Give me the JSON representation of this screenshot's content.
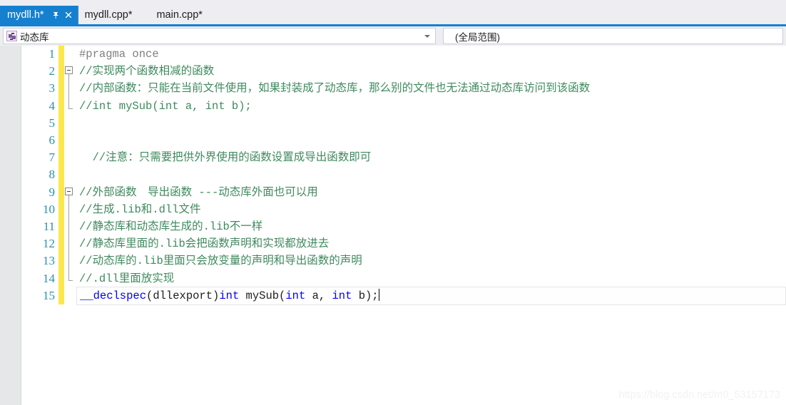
{
  "tabs": [
    {
      "label": "mydll.h*",
      "state": "active",
      "pin_icon": "pin-icon",
      "close_icon": "close-icon"
    },
    {
      "label": "mydll.cpp*",
      "state": "inactive"
    },
    {
      "label": "main.cpp*",
      "state": "plain"
    }
  ],
  "navbar": {
    "scope_combo": {
      "icon": "namespace-icon",
      "value": "动态库",
      "arrow_icon": "chevron-down-icon"
    },
    "member_combo": {
      "value": "(全局范围)"
    }
  },
  "editor": {
    "lines": [
      {
        "n": "1",
        "fold": "none",
        "changed": true,
        "text": "#pragma once"
      },
      {
        "n": "2",
        "fold": "start",
        "changed": true,
        "text": "//实现两个函数相减的函数"
      },
      {
        "n": "3",
        "fold": "mid",
        "changed": true,
        "text": "//内部函数：只能在当前文件使用，如果封装成了动态库，那么别的文件也无法通过动态库访问到该函数"
      },
      {
        "n": "4",
        "fold": "end",
        "changed": true,
        "text": "//int mySub(int a, int b);"
      },
      {
        "n": "5",
        "fold": "none",
        "changed": true,
        "text": ""
      },
      {
        "n": "6",
        "fold": "none",
        "changed": true,
        "text": ""
      },
      {
        "n": "7",
        "fold": "none",
        "changed": true,
        "text": "  //注意：只需要把供外界使用的函数设置成导出函数即可"
      },
      {
        "n": "8",
        "fold": "none",
        "changed": true,
        "text": ""
      },
      {
        "n": "9",
        "fold": "start",
        "changed": true,
        "text": "//外部函数　导出函数 ---动态库外面也可以用"
      },
      {
        "n": "10",
        "fold": "mid",
        "changed": true,
        "text": "//生成.lib和.dll文件"
      },
      {
        "n": "11",
        "fold": "mid",
        "changed": true,
        "text": "//静态库和动态库生成的.lib不一样"
      },
      {
        "n": "12",
        "fold": "mid",
        "changed": true,
        "text": "//静态库里面的.lib会把函数声明和实现都放进去"
      },
      {
        "n": "13",
        "fold": "mid",
        "changed": true,
        "text": "//动态库的.lib里面只会放变量的声明和导出函数的声明"
      },
      {
        "n": "14",
        "fold": "end",
        "changed": true,
        "text": "//.dll里面放实现"
      },
      {
        "n": "15",
        "fold": "none",
        "changed": true,
        "current": true,
        "segments": [
          {
            "t": "__declspec",
            "c": "kw"
          },
          {
            "t": "(dllexport)",
            "c": "pl"
          },
          {
            "t": "int",
            "c": "kw"
          },
          {
            "t": " mySub(",
            "c": "pl"
          },
          {
            "t": "int",
            "c": "kw"
          },
          {
            "t": " a, ",
            "c": "pl"
          },
          {
            "t": "int",
            "c": "kw"
          },
          {
            "t": " b);",
            "c": "pl"
          }
        ]
      }
    ]
  },
  "watermark": {
    "text": "https://blog.csdn.net/m0_53157173"
  },
  "colors": {
    "accent_blue": "#1580d0",
    "tabstrip_bg": "#eeeef2",
    "comment_green": "#3f8a5e",
    "keyword_blue": "#0000ff",
    "linenumber_blue": "#2b91af",
    "changebar_yellow": "#fbe74b",
    "indicator_margin_gray": "#e6e7e8"
  }
}
